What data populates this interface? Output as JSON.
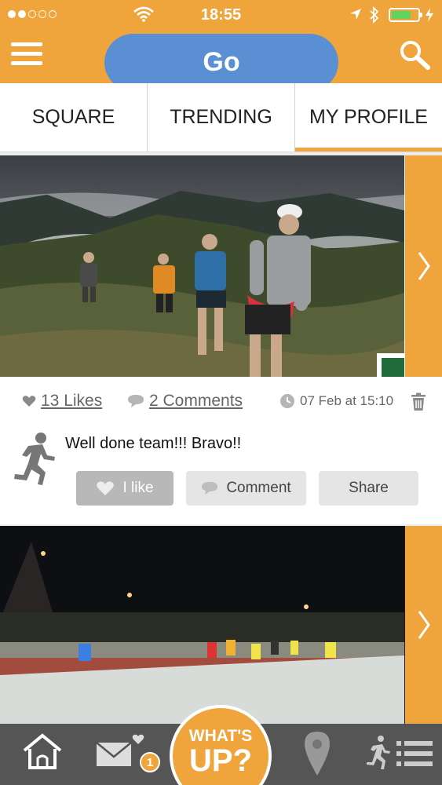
{
  "status_bar": {
    "time": "18:55",
    "signal_bars_filled": 2,
    "signal_bars_total": 5,
    "battery_level": 0.6
  },
  "header": {
    "go_label": "Go",
    "menu_icon": "hamburger-menu-icon",
    "search_icon": "search-icon"
  },
  "tabs": [
    {
      "label": "SQUARE",
      "active": false
    },
    {
      "label": "TRENDING",
      "active": false
    },
    {
      "label": "MY PROFILE",
      "active": true
    }
  ],
  "post": {
    "likes": "13 Likes",
    "comments": "2 Comments",
    "date": "07 Feb at 15:10",
    "text": "Well done team!!! Bravo!!",
    "actions": {
      "like": "I like",
      "comment": "Comment",
      "share": "Share"
    }
  },
  "bottom_nav": {
    "whats_up_line1": "WHAT'S",
    "whats_up_line2": "UP?",
    "messages_badge": "1"
  },
  "colors": {
    "accent": "#f0a43c",
    "go_button": "#5b8fd3",
    "bottom_bar": "#555555"
  }
}
